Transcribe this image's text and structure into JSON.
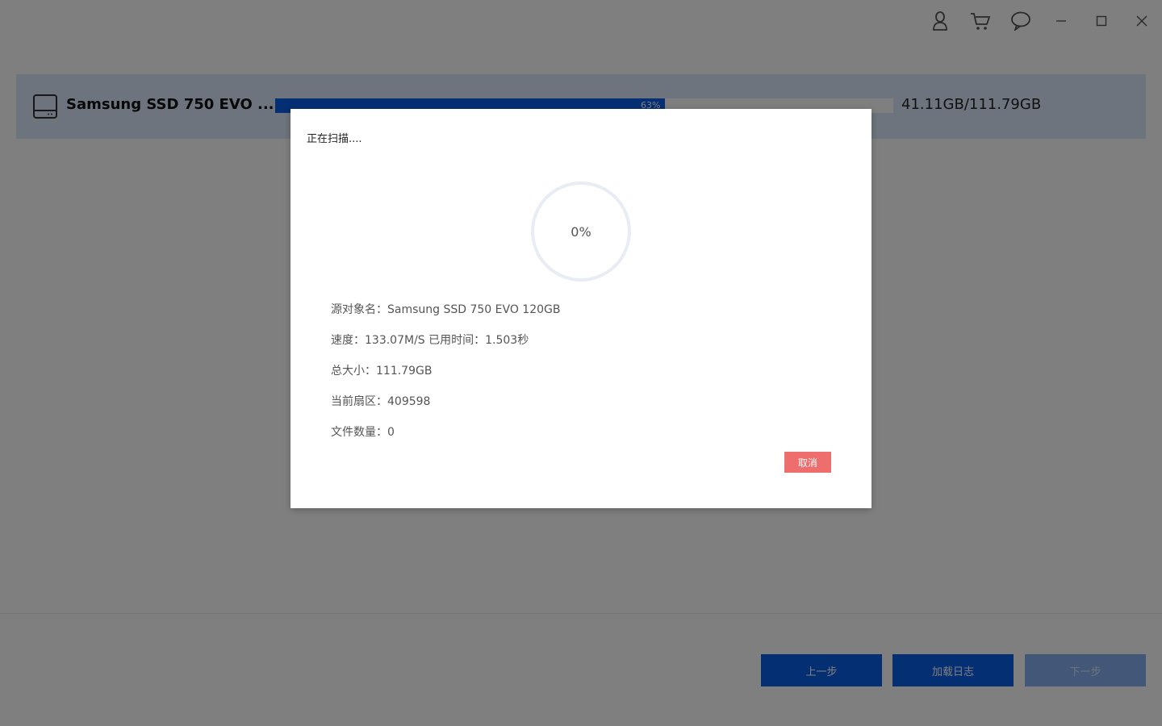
{
  "titlebar": {
    "icons": [
      "user-icon",
      "cart-icon",
      "chat-icon",
      "minimize-icon",
      "maximize-icon",
      "close-icon"
    ]
  },
  "disk": {
    "name": "Samsung SSD 750 EVO ...",
    "usage_percent": 63,
    "usage_label": "63%",
    "size_text": "41.11GB/111.79GB",
    "icon": "disk-icon"
  },
  "footer": {
    "prev_label": "上一步",
    "load_log_label": "加载日志",
    "next_label": "下一步"
  },
  "dialog": {
    "title": "正在扫描....",
    "progress_percent": 0,
    "progress_label": "0%",
    "source_label": "源对象名：",
    "source_value": "Samsung SSD 750 EVO 120GB",
    "speed_label": "速度：",
    "speed_value": "133.07M/S",
    "elapsed_label": "已用时间：",
    "elapsed_value": "1.503秒",
    "total_label": "总大小：",
    "total_value": "111.79GB",
    "sector_label": "当前扇区：",
    "sector_value": "409598",
    "files_label": "文件数量：",
    "files_value": "0",
    "cancel_label": "取消"
  },
  "colors": {
    "primary": "#0a5fe6",
    "card_bg": "#dbe9fb",
    "cancel": "#ee6d6d",
    "ring": "#e8ecf3"
  }
}
